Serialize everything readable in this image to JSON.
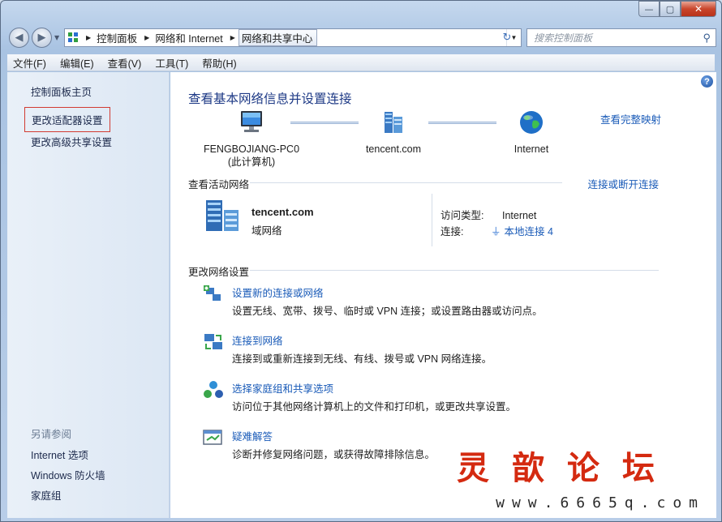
{
  "window": {
    "min": "0",
    "max": "1",
    "close": "r"
  },
  "address": {
    "crumbs": [
      "控制面板",
      "网络和 Internet",
      "网络和共享中心"
    ]
  },
  "search": {
    "placeholder": "搜索控制面板"
  },
  "menu": [
    "文件(F)",
    "编辑(E)",
    "查看(V)",
    "工具(T)",
    "帮助(H)"
  ],
  "sidebar": {
    "home": "控制面板主页",
    "adapter": "更改适配器设置",
    "advanced": "更改高级共享设置",
    "see_also": "另请参阅",
    "links": [
      "Internet 选项",
      "Windows 防火墙",
      "家庭组"
    ]
  },
  "main": {
    "title": "查看基本网络信息并设置连接",
    "full_map": "查看完整映射",
    "nodes": [
      {
        "line1": "FENGBOJIANG-PC0",
        "line2": "(此计算机)"
      },
      {
        "line1": "tencent.com",
        "line2": ""
      },
      {
        "line1": "Internet",
        "line2": ""
      }
    ],
    "active_title": "查看活动网络",
    "connect_link": "连接或断开连接",
    "network_name": "tencent.com",
    "network_type": "域网络",
    "access_label": "访问类型:",
    "access_value": "Internet",
    "conn_label": "连接:",
    "conn_value": "本地连接 4",
    "change_title": "更改网络设置",
    "tasks": [
      {
        "link": "设置新的连接或网络",
        "desc": "设置无线、宽带、拨号、临时或 VPN 连接；或设置路由器或访问点。"
      },
      {
        "link": "连接到网络",
        "desc": "连接到或重新连接到无线、有线、拨号或 VPN 网络连接。"
      },
      {
        "link": "选择家庭组和共享选项",
        "desc": "访问位于其他网络计算机上的文件和打印机，或更改共享设置。"
      },
      {
        "link": "疑难解答",
        "desc": "诊断并修复网络问题，或获得故障排除信息。"
      }
    ]
  },
  "watermark": {
    "title": "灵歆论坛",
    "url": "www.6665q.com"
  }
}
